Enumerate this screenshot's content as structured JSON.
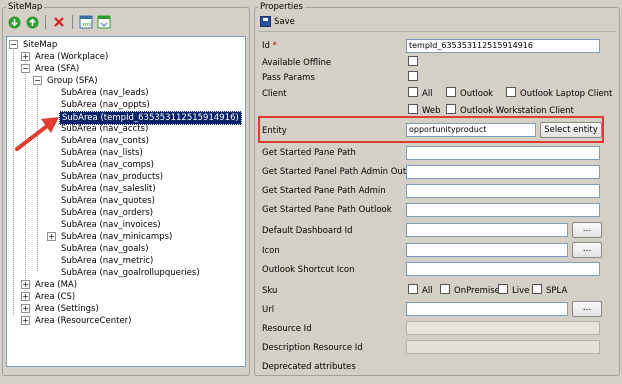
{
  "left": {
    "title": "SiteMap",
    "toolbar": {
      "icons": [
        "move-down-icon",
        "move-up-icon",
        "delete-icon",
        "export-icon",
        "import-icon"
      ],
      "colors": {
        "green": "#2e9b2e",
        "red": "#d42020"
      }
    },
    "tree": {
      "root": "SiteMap",
      "area_workplace": "Area (Workplace)",
      "area_sfa": "Area (SFA)",
      "group_sfa": "Group (SFA)",
      "subareas": [
        "SubArea (nav_leads)",
        "SubArea (nav_oppts)",
        "SubArea (tempId_635353112515914916)",
        "SubArea (nav_accts)",
        "SubArea (nav_conts)",
        "SubArea (nav_lists)",
        "SubArea (nav_comps)",
        "SubArea (nav_products)",
        "SubArea (nav_saleslit)",
        "SubArea (nav_quotes)",
        "SubArea (nav_orders)",
        "SubArea (nav_invoices)",
        "SubArea (nav_minicamps)",
        "SubArea (nav_goals)",
        "SubArea (nav_metric)",
        "SubArea (nav_goalrollupqueries)"
      ],
      "other_areas": [
        "Area (MA)",
        "Area (CS)",
        "Area (Settings)",
        "Area (ResourceCenter)"
      ]
    }
  },
  "right": {
    "title": "Properties",
    "save_label": "Save",
    "id_label": "Id",
    "required_mark": "*",
    "id_value": "tempId_635353112515914916",
    "available_offline_label": "Available Offline",
    "pass_params_label": "Pass Params",
    "client_label": "Client",
    "client_options": {
      "all": "All",
      "outlook": "Outlook",
      "outlook_laptop": "Outlook Laptop Client",
      "web": "Web",
      "outlook_workstation": "Outlook Workstation Client"
    },
    "entity_label": "Entity",
    "entity_value": "opportunityproduct",
    "select_entity_label": "Select entity",
    "get_started_pane_path": "Get Started Pane Path",
    "get_started_panel_path_admin_outlook": "Get Started Panel Path Admin Outlook",
    "get_started_pane_path_admin": "Get Started Pane Path Admin",
    "get_started_pane_path_outlook": "Get Started Pane Path Outlook",
    "default_dashboard_id": "Default Dashboard Id",
    "icon": "Icon",
    "outlook_shortcut_icon": "Outlook Shortcut Icon",
    "sku": "Sku",
    "sku_options": {
      "all": "All",
      "onpremise": "OnPremise",
      "live": "Live",
      "spla": "SPLA"
    },
    "url": "Url",
    "resource_id": "Resource Id",
    "description_resource_id": "Description Resource Id",
    "deprecated_attributes": "Deprecated attributes",
    "ellipsis": "...",
    "highlight_color": "#e03c31"
  }
}
